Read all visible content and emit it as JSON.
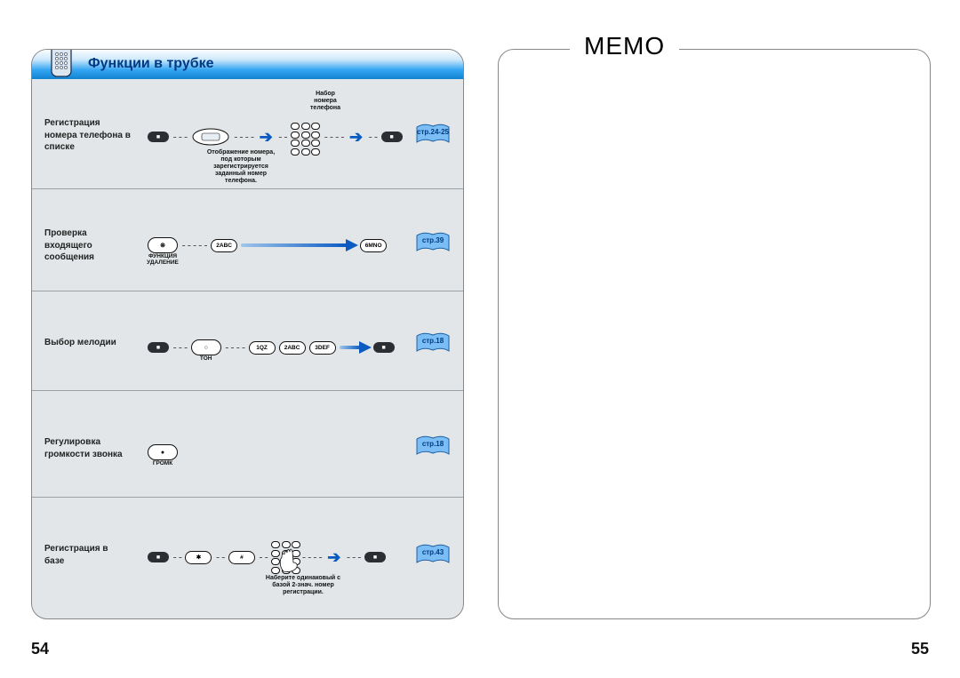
{
  "pageLeft": "54",
  "pageRight": "55",
  "memo": "MEMO",
  "title": "Функции в трубке",
  "rows": [
    {
      "label": "Регистрация\nномера телефона в\nсписке",
      "lcdCaption": "Отображение номера,\nпод которым\nзарегистрируется\nзаданный номер\nтелефона.",
      "keypadCaption": "Набор\nномера\nтелефона",
      "page": "стр.24-25"
    },
    {
      "label": "Проверка\nвходящего\nсообщения",
      "btnUnder": "ФУНКЦИЯ\nУДАЛЕНИЕ",
      "btn2": "2ABC",
      "btnEnd": "6MNO",
      "page": "стр.39"
    },
    {
      "label": "Выбор мелодии",
      "tonUnder": "ТОН",
      "k1": "1QZ",
      "k2": "2ABC",
      "k3": "3DEF",
      "page": "стр.18"
    },
    {
      "label": "Регулировка\nгромкости звонка",
      "vol": "ГРОМК",
      "page": "стр.18"
    },
    {
      "label": "Регистрация в\nбазе",
      "star": "✱",
      "hash": "#",
      "footnote": "Наберите одинаковый с\nбазой 2-знач. номер\nрегистрации.",
      "page": "стр.43"
    }
  ]
}
